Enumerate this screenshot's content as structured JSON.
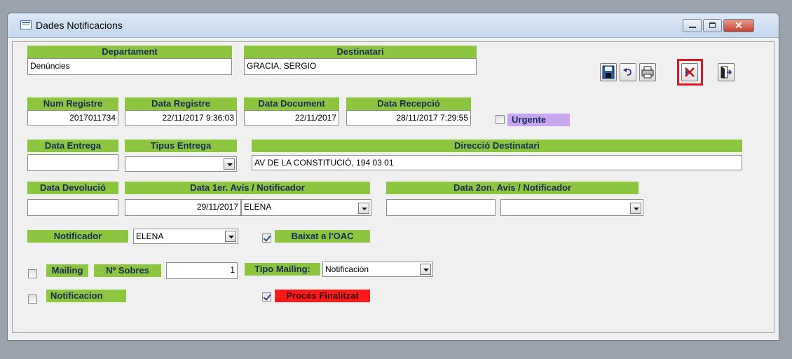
{
  "window": {
    "title": "Dades Notificacions"
  },
  "fields": {
    "departament": {
      "label": "Departament",
      "value": "Denúncies"
    },
    "destinatari": {
      "label": "Destinatari",
      "value": "GRACIA, SERGIO"
    },
    "num_registre": {
      "label": "Num Registre",
      "value": "2017011734"
    },
    "data_registre": {
      "label": "Data Registre",
      "value": "22/11/2017 9:36:03"
    },
    "data_document": {
      "label": "Data Document",
      "value": "22/11/2017"
    },
    "data_recepcio": {
      "label": "Data Recepció",
      "value": "28/11/2017 7:29:55"
    },
    "urgente": {
      "label": "Urgente",
      "checked": false
    },
    "data_entrega": {
      "label": "Data Entrega",
      "value": ""
    },
    "tipus_entrega": {
      "label": "Tipus Entrega",
      "value": ""
    },
    "direccio": {
      "label": "Direcció Destinatari",
      "value": "AV DE LA CONSTITUCIÓ,  194 03 01"
    },
    "data_devolucio": {
      "label": "Data Devolució",
      "value": ""
    },
    "aviso1": {
      "label": "Data 1er.  Avís / Notificador",
      "date": "29/11/2017",
      "notificador": "ELENA"
    },
    "aviso2": {
      "label": "Data 2on.  Avís / Notificador",
      "date": "",
      "notificador": ""
    },
    "notificador": {
      "label": "Notificador",
      "value": "ELENA"
    },
    "baixat_oac": {
      "label": "Baixat a l'OAC",
      "checked": true
    },
    "mailing": {
      "label": "Mailing",
      "checked": false
    },
    "n_sobres": {
      "label": "Nº Sobres",
      "value": "1"
    },
    "tipo_mailing": {
      "label": "Tipo Mailing:",
      "value": "Notificación"
    },
    "notificacion": {
      "label": "Notificacion",
      "checked": false
    },
    "proces_finalitzat": {
      "label": "Procés Finalitzat",
      "checked": true
    }
  },
  "toolbar": [
    "save-icon",
    "undo-icon",
    "print-icon",
    "cancel-icon",
    "exit-icon"
  ],
  "colors": {
    "label_bg": "#8cc63e",
    "label_text": "#1a2a5a",
    "urgent_bg": "#c9a6f0",
    "finalitzat_bg": "#ff1a1a",
    "highlight": "#e0171e"
  }
}
